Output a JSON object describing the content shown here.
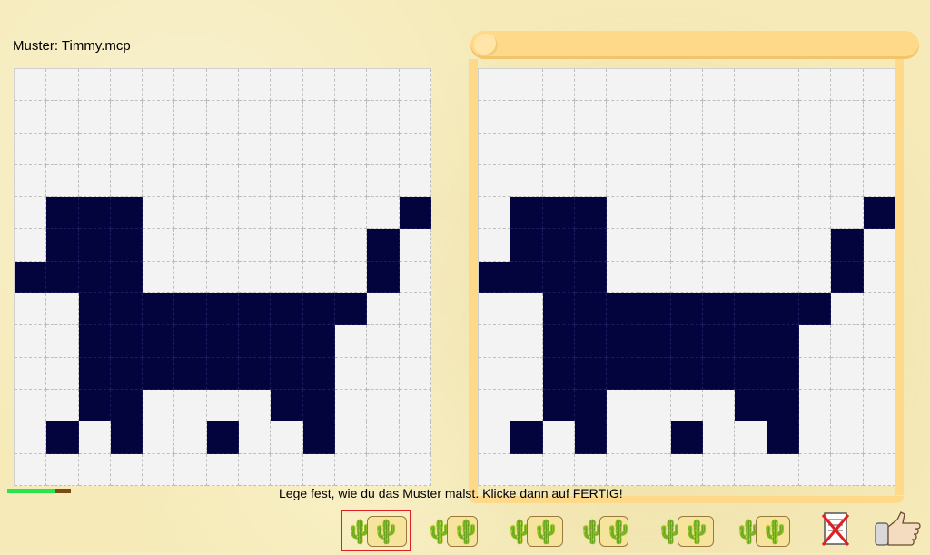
{
  "window": {
    "pattern_label": "Muster: Timmy.mcp"
  },
  "status": {
    "progress": 0.75,
    "progress_color": "#27e54a",
    "instruction": "Lege fest, wie du das Muster malst. Klicke dann auf FERTIG!"
  },
  "colors": {
    "pixel_on": "#03033d",
    "pixel_off": "#f3f3f3",
    "scroll": "#ffd98a"
  },
  "pattern": [
    "0000000000000",
    "0000000000000",
    "0000000000000",
    "0000000000000",
    "0111000000001",
    "0111000000010",
    "1111000000010",
    "0011111111100",
    "0011111111000",
    "0011111111000",
    "0011000011000",
    "0101001001000",
    "0000000000000"
  ],
  "toolbar": {
    "tools": [
      {
        "name": "tool-row-left-to-right",
        "icon": "cactus-scroll-icon"
      },
      {
        "name": "tool-row-right-to-left",
        "icon": "cactus-scroll-icon"
      },
      {
        "name": "tool-row-double",
        "icon": "cactus-scroll-icon"
      },
      {
        "name": "tool-column-down",
        "icon": "cactus-scroll-icon"
      },
      {
        "name": "tool-rotate",
        "icon": "cactus-scroll-icon"
      },
      {
        "name": "tool-rotate-back",
        "icon": "cactus-scroll-icon"
      }
    ],
    "selected_index": 0,
    "clear_icon": "crossed-paper-icon",
    "done_icon": "thumbs-up-hand-icon"
  }
}
